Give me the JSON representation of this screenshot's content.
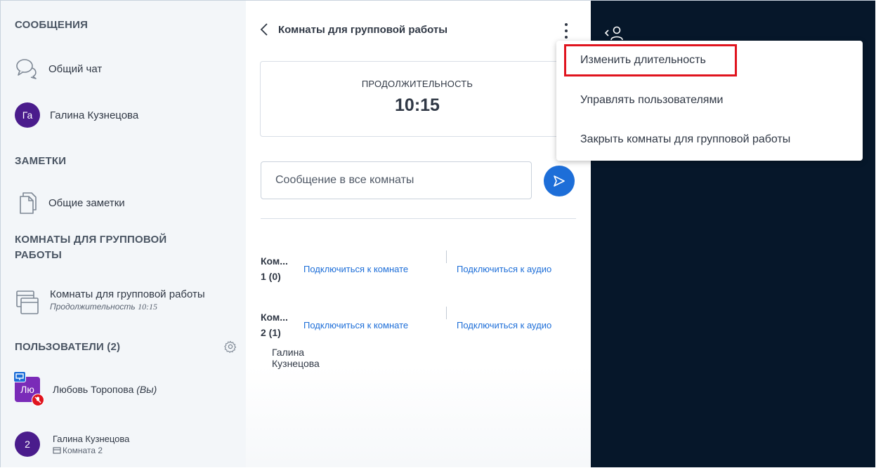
{
  "sidebar": {
    "messages_title": "СООБЩЕНИЯ",
    "public_chat": "Общий чат",
    "private_chat_user": "Галина Кузнецова",
    "private_chat_avatar": "Га",
    "notes_title": "ЗАМЕТКИ",
    "shared_notes": "Общие заметки",
    "breakout_title_line1": "КОМНАТЫ ДЛЯ ГРУППОВОЙ",
    "breakout_title_line2": "РАБОТЫ",
    "breakout_item": "Комнаты для групповой работы",
    "breakout_duration_label": "Продолжительность",
    "breakout_duration_value": "10:15",
    "users_title": "ПОЛЬЗОВАТЕЛИ (2)",
    "users": [
      {
        "avatar": "Лю",
        "name": "Любовь Торопова",
        "suffix": "(Вы)"
      },
      {
        "avatar": "2",
        "name": "Галина Кузнецова",
        "room": "Комната 2"
      }
    ]
  },
  "panel": {
    "title": "Комнаты для групповой работы",
    "duration_label": "ПРОДОЛЖИТЕЛЬНОСТЬ",
    "duration_value": "10:15",
    "message_placeholder": "Сообщение в все комнаты",
    "rooms": [
      {
        "name_line1": "Ком...",
        "name_line2": "1 (0)",
        "join_room": "Подключиться к комнате",
        "join_audio": "Подключиться к аудио",
        "users": []
      },
      {
        "name_line1": "Ком...",
        "name_line2": "2 (1)",
        "join_room": "Подключиться к комнате",
        "join_audio": "Подключиться к аудио",
        "users": [
          "Галина Кузнецова"
        ]
      }
    ]
  },
  "menu": {
    "items": [
      "Изменить длительность",
      "Управлять пользователями",
      "Закрыть комнаты для групповой работы"
    ],
    "highlighted_index": 0
  },
  "colors": {
    "sidebar_bg": "#f3f6f9",
    "accent": "#1d6ed8",
    "avatar_purple": "#4a1c8c",
    "presenter_purple": "#7a2bb8",
    "dark_area": "#06172a",
    "highlight_red": "#e0141e"
  },
  "icons": [
    "chat-bubbles-icon",
    "notes-icon",
    "breakout-rooms-icon",
    "gear-icon",
    "back-chevron-icon",
    "more-vertical-icon",
    "send-icon",
    "presentation-icon",
    "muted-mic-icon",
    "room-icon",
    "user-toggle-icon"
  ]
}
